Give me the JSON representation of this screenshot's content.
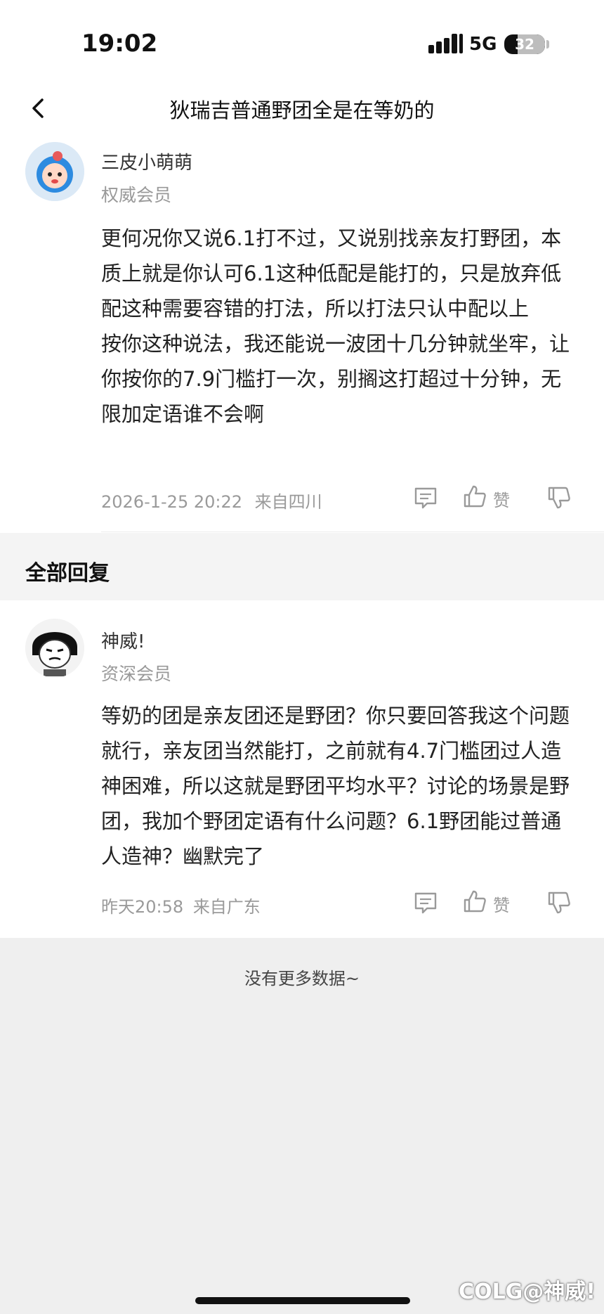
{
  "status_bar": {
    "time": "19:02",
    "network": "5G",
    "battery": "32",
    "battery_level": 0.32
  },
  "header": {
    "title": "狄瑞吉普通野团全是在等奶的"
  },
  "post": {
    "author": "三皮小萌萌",
    "role": "权威会员",
    "content": "更何况你又说6.1打不过，又说别找亲友打野团，本质上就是你认可6.1这种低配是能打的，只是放弃低配这种需要容错的打法，所以打法只认中配以上\n按你这种说法，我还能说一波团十几分钟就坐牢，让你按你的7.9门槛打一次，别搁这打超过十分钟，无限加定语谁不会啊",
    "timestamp": "2026-1-25 20:22",
    "location": "来自四川",
    "like_label": "赞"
  },
  "section": {
    "title": "全部回复"
  },
  "reply": {
    "author": "神威!",
    "role": "资深会员",
    "content": "等奶的团是亲友团还是野团？你只要回答我这个问题就行，亲友团当然能打，之前就有4.7门槛团过人造神困难，所以这就是野团平均水平？讨论的场景是野团，我加个野团定语有什么问题？6.1野团能过普通人造神？幽默完了",
    "timestamp": "昨天20:58",
    "location": "来自广东",
    "like_label": "赞"
  },
  "footer": {
    "no_more": "没有更多数据~",
    "watermark": "COLG@神威!"
  },
  "colors": {
    "accent_blue": "#3d8fe0",
    "icon_gray": "#9a9a9a",
    "page_bg": "#efefef"
  },
  "icons": [
    "back-arrow",
    "comment-icon",
    "thumbs-up-icon",
    "thumbs-down-icon"
  ]
}
